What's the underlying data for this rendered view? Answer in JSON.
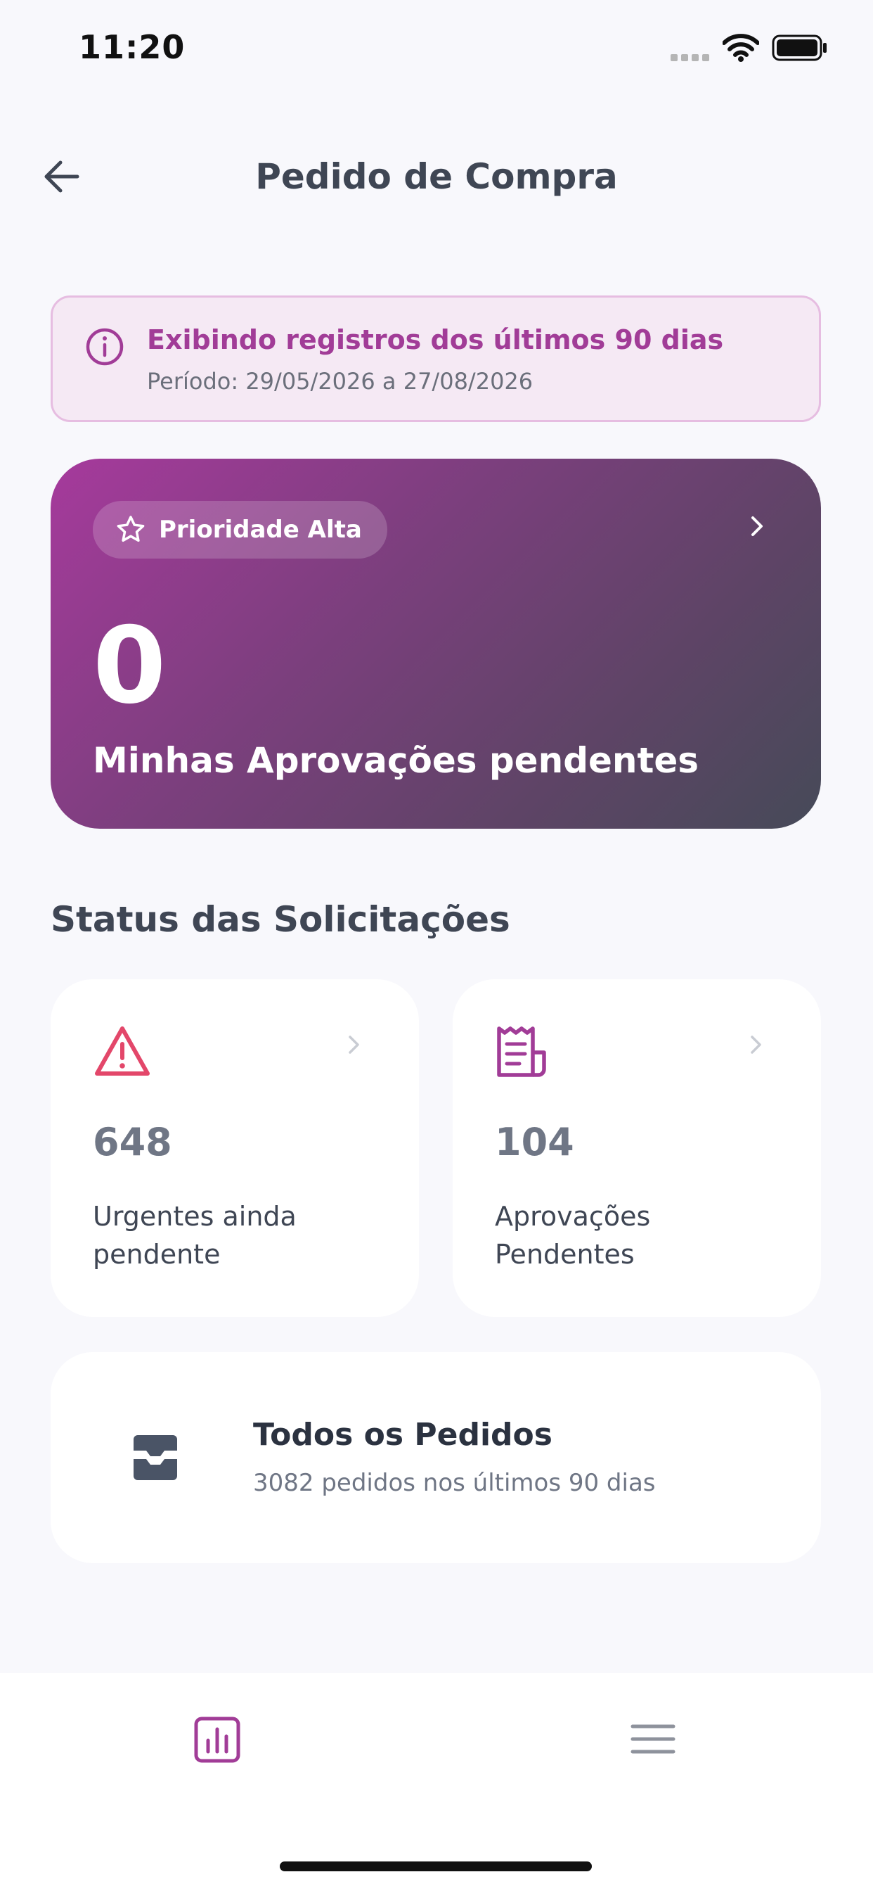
{
  "status_bar": {
    "time": "11:20"
  },
  "header": {
    "title": "Pedido de Compra"
  },
  "info_banner": {
    "title": "Exibindo registros dos últimos 90 dias",
    "subtitle": "Período: 29/05/2026 a 27/08/2026"
  },
  "priority_card": {
    "badge_label": "Prioridade Alta",
    "count": "0",
    "label": "Minhas Aprovações pendentes"
  },
  "status_section": {
    "title": "Status das Solicitações",
    "cards": [
      {
        "value": "648",
        "label": "Urgentes ainda pendente",
        "icon": "warning-icon",
        "icon_color": "#e3476a"
      },
      {
        "value": "104",
        "label": "Aprovações Pendentes",
        "icon": "receipt-icon",
        "icon_color": "#a13c97"
      }
    ]
  },
  "orders_card": {
    "title": "Todos os Pedidos",
    "subtitle": "3082 pedidos nos últimos 90 dias",
    "icon": "inbox-icon"
  },
  "tab_bar": {
    "items": [
      {
        "icon": "bar-chart-icon",
        "active": true
      },
      {
        "icon": "menu-icon",
        "active": false
      }
    ]
  },
  "colors": {
    "accent": "#a13c97",
    "background": "#f8f8fc",
    "text_primary": "#3f4654",
    "warning": "#e3476a"
  }
}
